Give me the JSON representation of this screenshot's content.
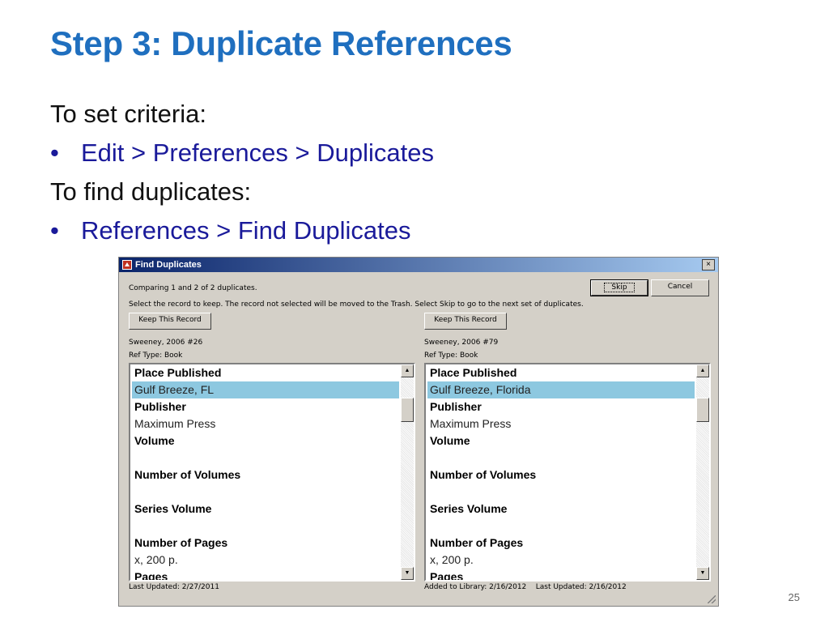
{
  "slide": {
    "title": "Step 3: Duplicate References",
    "line1": "To set criteria:",
    "bullet1": "Edit > Preferences > Duplicates",
    "line2": "To find duplicates:",
    "bullet2": "References > Find Duplicates",
    "bullet_char": "•",
    "page_number": "25"
  },
  "dialog": {
    "title": "Find Duplicates",
    "close": "×",
    "comparing": "Comparing 1 and 2 of 2 duplicates.",
    "instruction": "Select the record to keep. The record not selected will be moved to the Trash. Select Skip to go to the next set of duplicates.",
    "skip_label": "Skip",
    "cancel_label": "Cancel",
    "left": {
      "keep_label": "Keep This Record",
      "citation": "Sweeney, 2006 #26",
      "ref_type": "Ref Type: Book",
      "place_published_label": "Place Published",
      "place_published": "Gulf Breeze, FL",
      "publisher_label": "Publisher",
      "publisher": "Maximum Press",
      "volume_label": "Volume",
      "num_volumes_label": "Number of Volumes",
      "series_volume_label": "Series Volume",
      "num_pages_label": "Number of Pages",
      "num_pages": "x, 200 p.",
      "pages_label": "Pages",
      "footer": "Last Updated: 2/27/2011"
    },
    "right": {
      "keep_label": "Keep This Record",
      "citation": "Sweeney, 2006 #79",
      "ref_type": "Ref Type: Book",
      "place_published_label": "Place Published",
      "place_published": "Gulf Breeze, Florida",
      "publisher_label": "Publisher",
      "publisher": "Maximum Press",
      "volume_label": "Volume",
      "num_volumes_label": "Number of Volumes",
      "series_volume_label": "Series Volume",
      "num_pages_label": "Number of Pages",
      "num_pages": "x, 200 p.",
      "pages_label": "Pages",
      "footer": "Added to Library: 2/16/2012    Last Updated: 2/16/2012"
    }
  },
  "colors": {
    "title_blue": "#1f6fbf",
    "bullet_navy": "#1a1a9a",
    "selection": "#8dc8e0"
  },
  "icons": [
    "app-icon",
    "close-icon",
    "scroll-up-icon",
    "scroll-down-icon",
    "resize-grip-icon"
  ]
}
